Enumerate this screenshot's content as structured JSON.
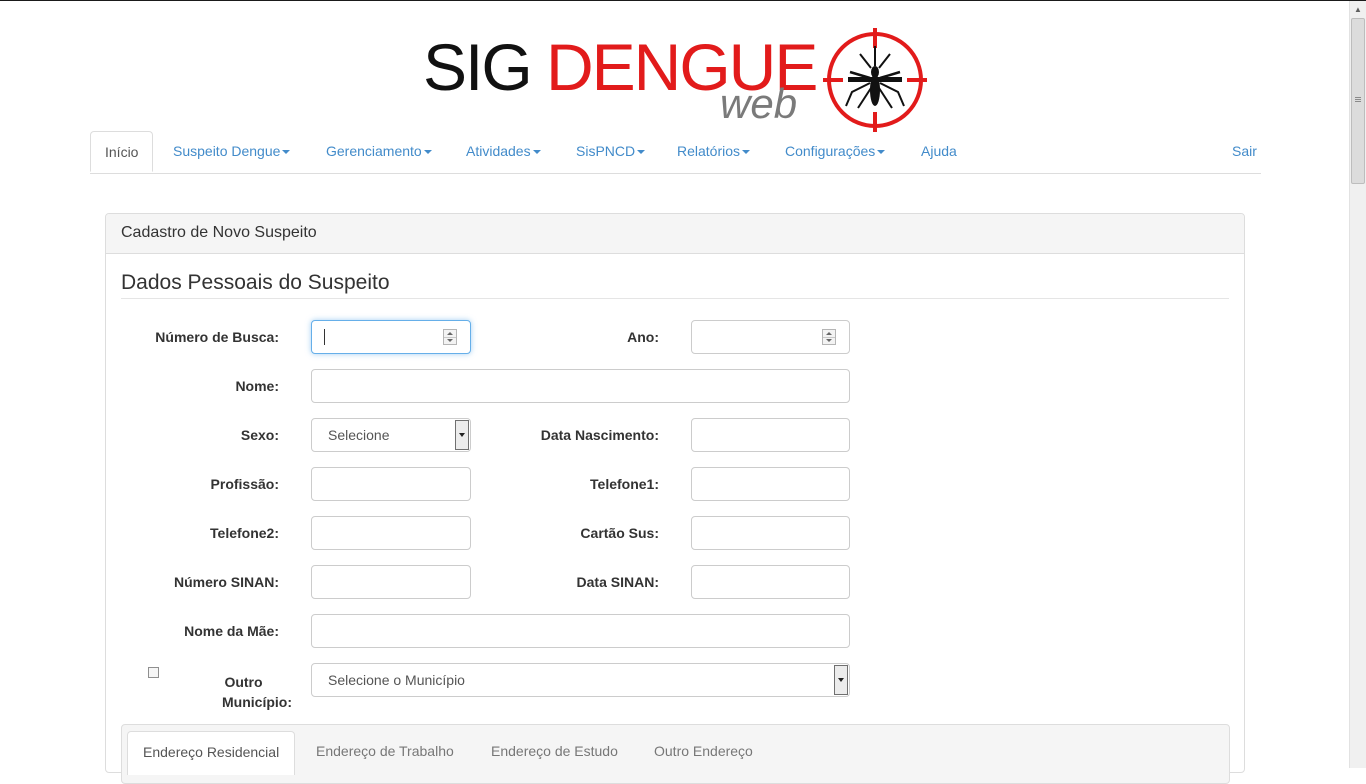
{
  "logo": {
    "part1": "SIG",
    "part2": "DENGUE",
    "part3": "web",
    "colors": {
      "sig": "#111111",
      "dengue": "#e21b1b",
      "web": "#7a7a7a",
      "target": "#e21b1b"
    },
    "emblem_icon": "mosquito-crosshair-icon"
  },
  "nav": {
    "items": [
      {
        "label": "Início",
        "active": true
      },
      {
        "label": "Suspeito Dengue",
        "dropdown": true
      },
      {
        "label": "Gerenciamento",
        "dropdown": true
      },
      {
        "label": "Atividades",
        "dropdown": true
      },
      {
        "label": "SisPNCD",
        "dropdown": true
      },
      {
        "label": "Relatórios",
        "dropdown": true
      },
      {
        "label": "Configurações",
        "dropdown": true
      },
      {
        "label": "Ajuda"
      }
    ],
    "logout": "Sair",
    "link_color": "#428bca"
  },
  "panel": {
    "heading": "Cadastro de Novo Suspeito",
    "section_title": "Dados Pessoais do Suspeito"
  },
  "form": {
    "numero_busca": {
      "label": "Número de Busca:",
      "value": ""
    },
    "ano": {
      "label": "Ano:",
      "value": ""
    },
    "nome": {
      "label": "Nome:",
      "value": ""
    },
    "sexo": {
      "label": "Sexo:",
      "selected": "Selecione"
    },
    "data_nascimento": {
      "label": "Data Nascimento:",
      "value": ""
    },
    "profissao": {
      "label": "Profissão:",
      "value": ""
    },
    "telefone1": {
      "label": "Telefone1:",
      "value": ""
    },
    "telefone2": {
      "label": "Telefone2:",
      "value": ""
    },
    "cartao_sus": {
      "label": "Cartão Sus:",
      "value": ""
    },
    "numero_sinan": {
      "label": "Número SINAN:",
      "value": ""
    },
    "data_sinan": {
      "label": "Data SINAN:",
      "value": ""
    },
    "nome_mae": {
      "label": "Nome da Mãe:",
      "value": ""
    },
    "outro_municipio": {
      "label_line1": "Outro",
      "label_line2": "Município:",
      "checked": false,
      "selected": "Selecione o Município"
    }
  },
  "address_tabs": {
    "items": [
      {
        "label": "Endereço Residencial",
        "active": true
      },
      {
        "label": "Endereço de Trabalho"
      },
      {
        "label": "Endereço de Estudo"
      },
      {
        "label": "Outro Endereço"
      }
    ]
  }
}
